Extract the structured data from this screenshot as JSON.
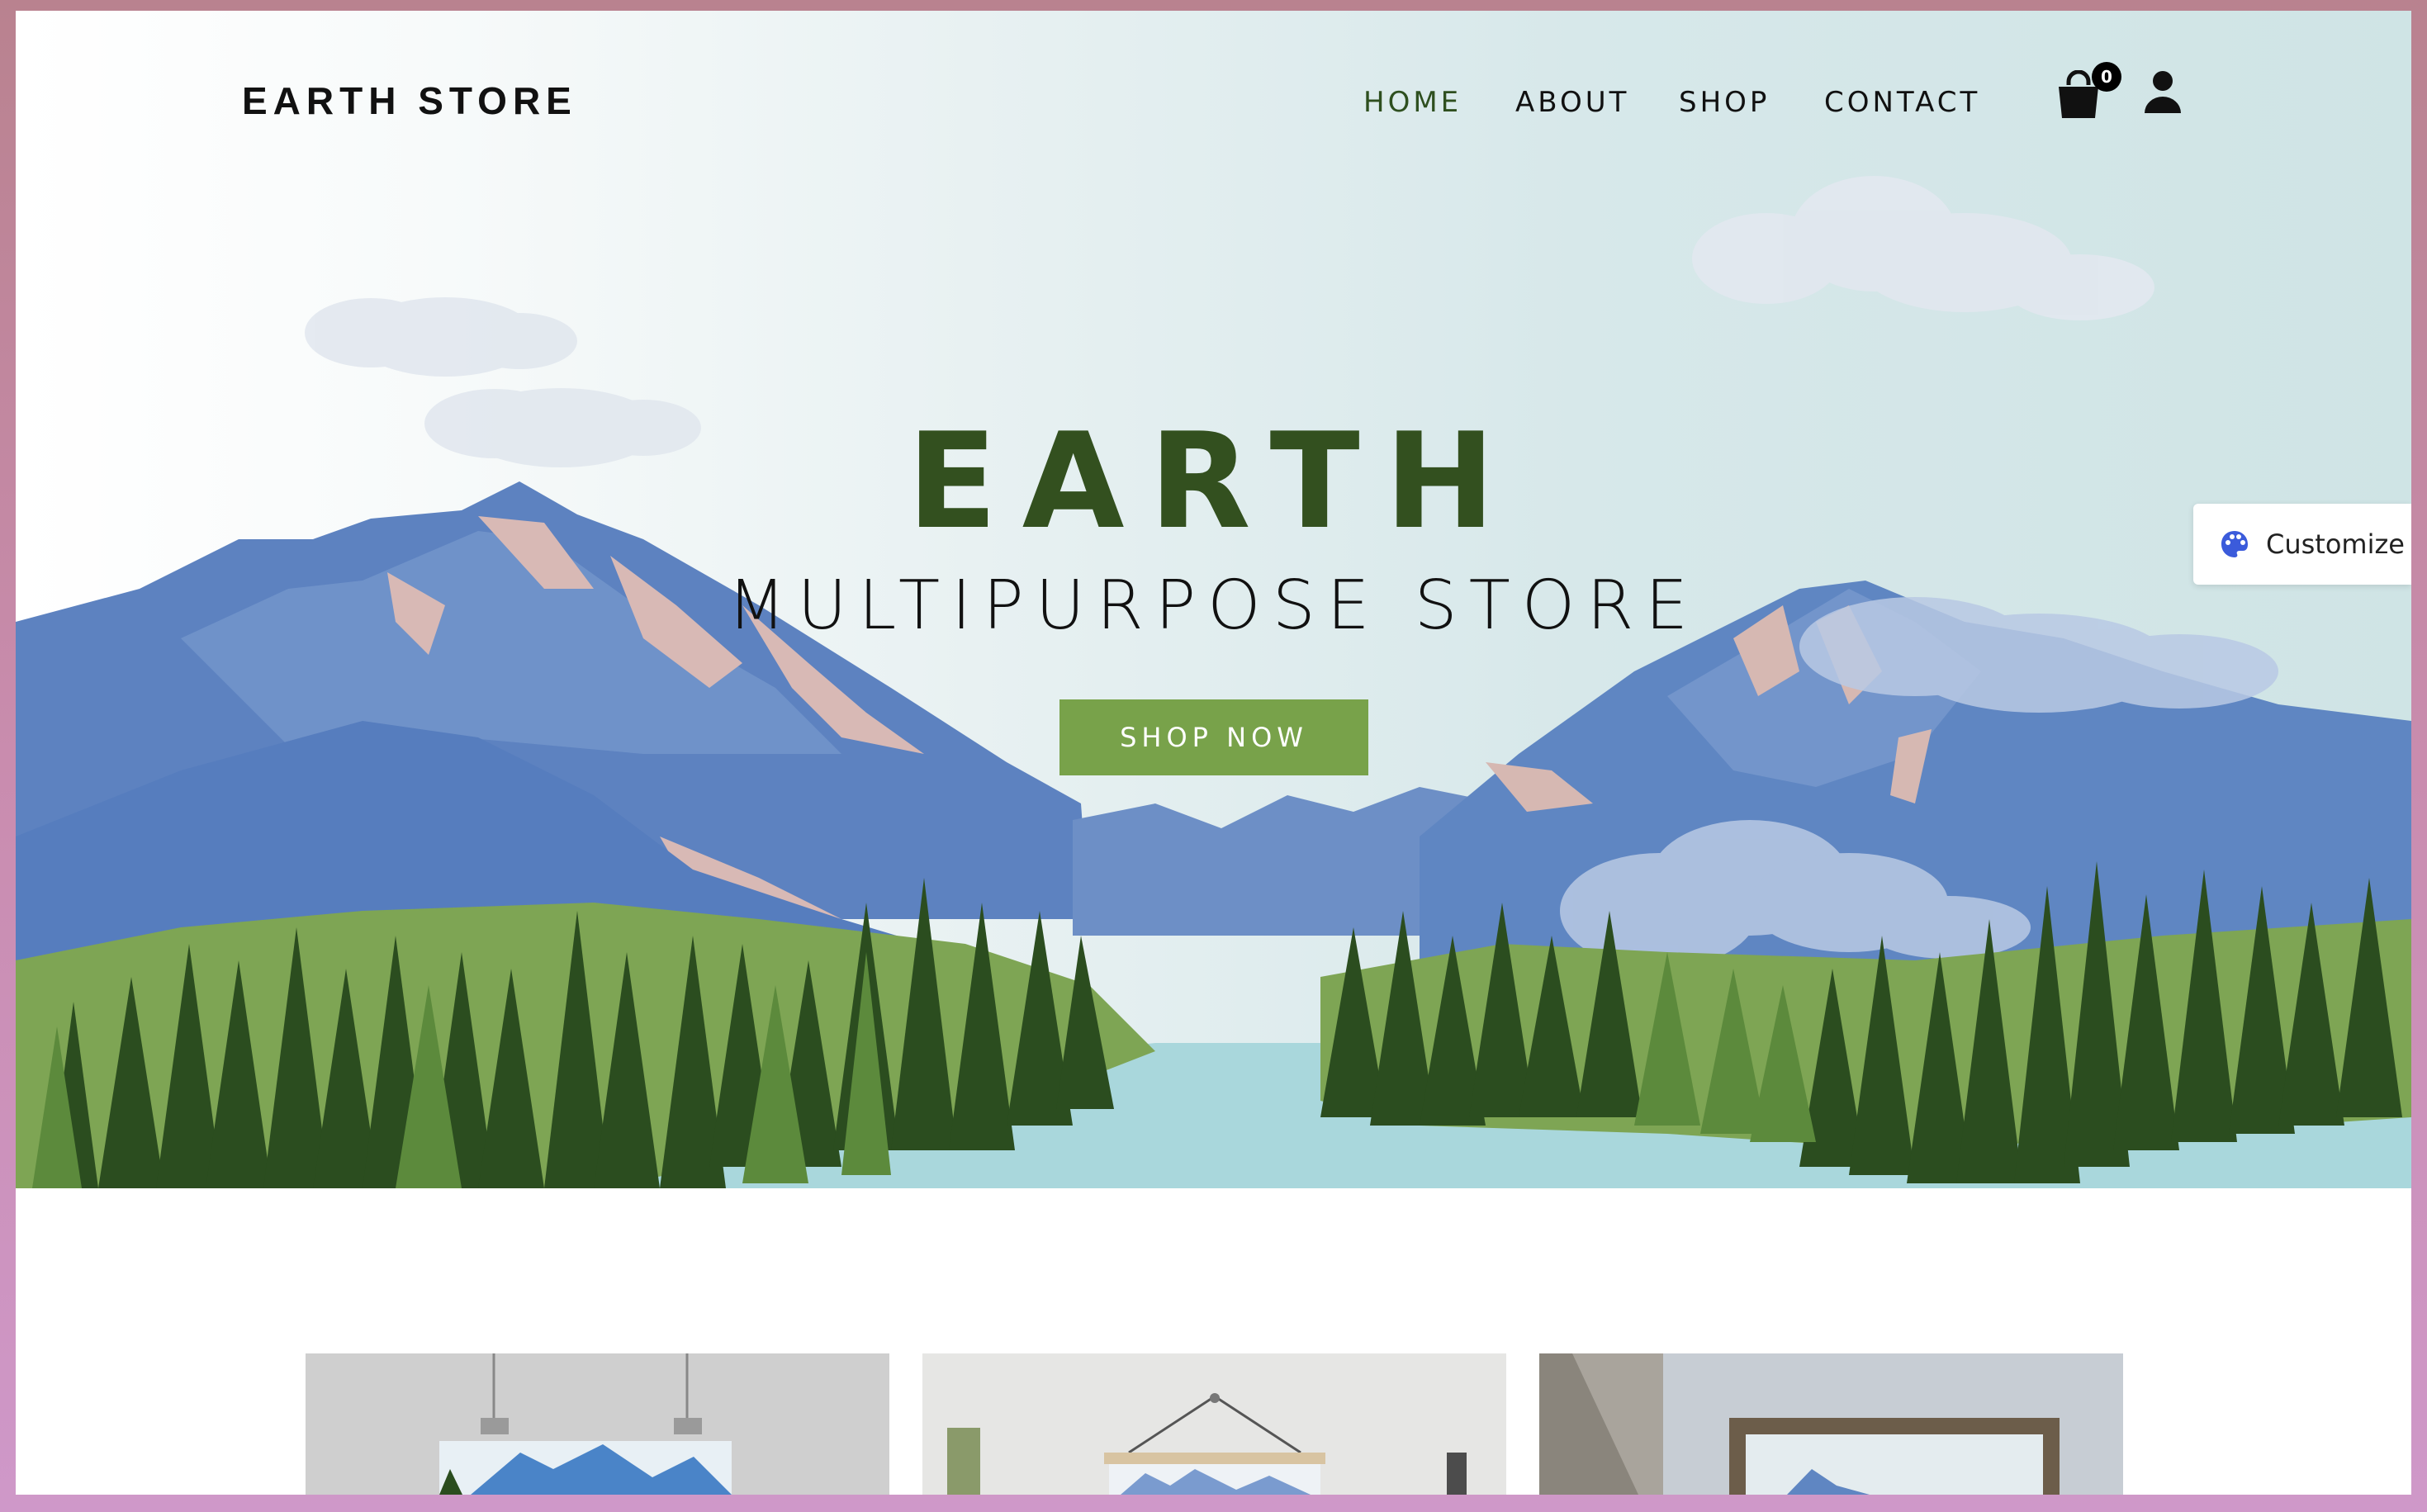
{
  "site": {
    "logo": "EARTH STORE",
    "nav": [
      "HOME",
      "ABOUT",
      "SHOP",
      "CONTACT"
    ],
    "active_nav": "HOME",
    "cart_count": "0",
    "icons": {
      "cart": "shopping-bag-icon",
      "account": "user-icon",
      "customize": "palette-icon"
    }
  },
  "hero": {
    "title": "EARTH",
    "subtitle": "MULTIPURPOSE STORE",
    "cta": "SHOP NOW"
  },
  "customize": {
    "label": "Customize"
  },
  "colors": {
    "brand_green": "#33501f",
    "button_green": "#78a24a",
    "active_nav": "#2e4f1f",
    "mountain_blue": "#5f86c2",
    "forest_dark": "#2b4d1f",
    "lake": "#a9d7dc"
  }
}
